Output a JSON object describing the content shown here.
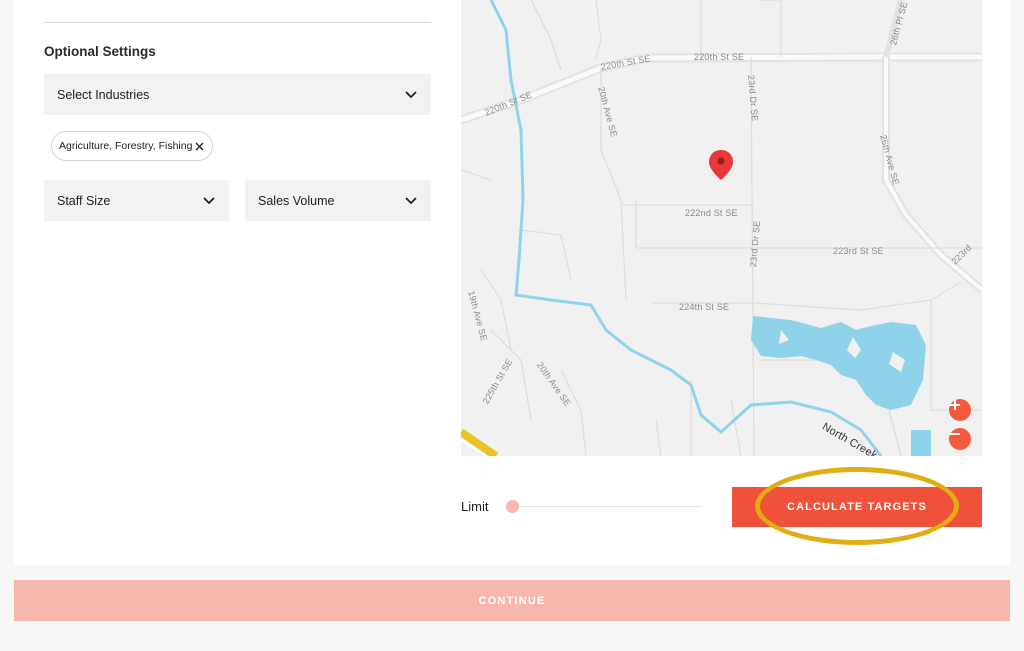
{
  "optional_settings": {
    "title": "Optional Settings",
    "industries": {
      "label": "Select Industries",
      "icon": "chevron-down-icon"
    },
    "selected_chips": [
      {
        "label": "Agriculture, Forestry, Fishing",
        "remove_icon": "close-icon"
      }
    ],
    "staff_size": {
      "label": "Staff Size",
      "icon": "chevron-down-icon"
    },
    "sales_volume": {
      "label": "Sales Volume",
      "icon": "chevron-down-icon"
    }
  },
  "map": {
    "streets": [
      "220th St SE",
      "220th St SE",
      "220th St SE",
      "26th Pl SE",
      "20th Ave SE",
      "23rd Dr SE",
      "26th Ave SE",
      "222nd St SE",
      "223rd St SE",
      "223rd",
      "23rd Dr SE",
      "224th St SE",
      "19th Ave SE",
      "20th Ave SE",
      "225th St SE",
      "North Creek"
    ],
    "marker_color": "#e8373a",
    "water_color": "#8fd3ea",
    "zoom_in": "+",
    "zoom_out": "−"
  },
  "limit": {
    "label": "Limit",
    "value_fraction": 0
  },
  "calculate_button": {
    "label": "CALCULATE TARGETS"
  },
  "continue_button": {
    "label": "CONTINUE"
  },
  "colors": {
    "accent": "#f0513a",
    "accent_light": "#f8b7ad",
    "highlight": "#e1ad10"
  }
}
